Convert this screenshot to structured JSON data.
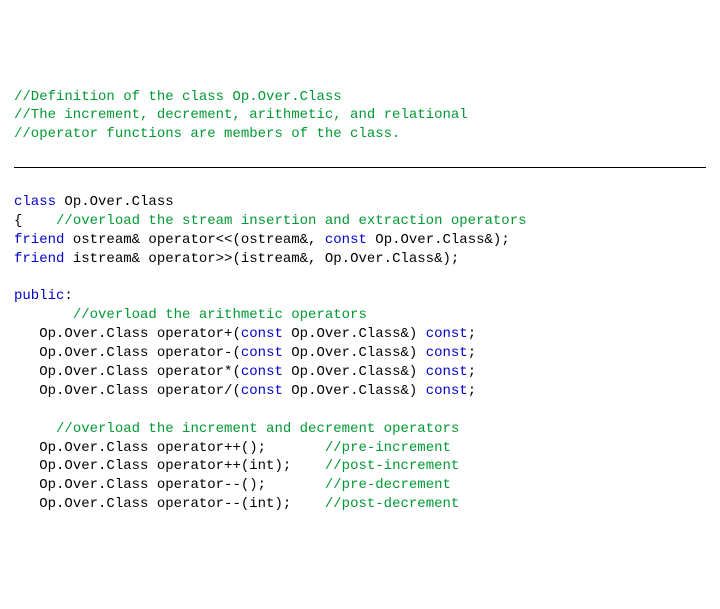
{
  "header_comments": [
    "//Definition of the class Op.Over.Class",
    "//The increment, decrement, arithmetic, and relational",
    "//operator functions are members of the class."
  ],
  "class_decl": {
    "kw": "class",
    "name": "Op.Over.Class"
  },
  "stream_block": {
    "open_brace": "{",
    "comment": "//overload the stream insertion and extraction operators",
    "line1": {
      "kw": "friend",
      "rest": " ostream& operator<<(ostream&, ",
      "const_kw": "const",
      "tail": " Op.Over.Class&);"
    },
    "line2": {
      "kw": "friend",
      "rest": " istream& operator>>(istream&, Op.Over.Class&);"
    }
  },
  "public_kw": "public",
  "public_colon": ":",
  "arith_comment": "//overload the arithmetic operators",
  "arith_ops": [
    {
      "ret": "Op.Over.Class",
      "fn": "operator+(",
      "ckw": "const",
      "arg": " Op.Over.Class&) ",
      "tkw": "const",
      "end": ";"
    },
    {
      "ret": "Op.Over.Class",
      "fn": "operator-(",
      "ckw": "const",
      "arg": " Op.Over.Class&) ",
      "tkw": "const",
      "end": ";"
    },
    {
      "ret": "Op.Over.Class",
      "fn": "operator*(",
      "ckw": "const",
      "arg": " Op.Over.Class&) ",
      "tkw": "const",
      "end": ";"
    },
    {
      "ret": "Op.Over.Class",
      "fn": "operator/(",
      "ckw": "const",
      "arg": " Op.Over.Class&) ",
      "tkw": "const",
      "end": ";"
    }
  ],
  "incdec_comment": "//overload the increment and decrement operators",
  "incdec_ops": [
    {
      "ret": "Op.Over.Class",
      "fn": "operator++();",
      "pad": "       ",
      "cmt": "//pre-increment"
    },
    {
      "ret": "Op.Over.Class",
      "fn": "operator++(int);",
      "pad": "    ",
      "cmt": "//post-increment"
    },
    {
      "ret": "Op.Over.Class",
      "fn": "operator--();",
      "pad": "       ",
      "cmt": "//pre-decrement"
    },
    {
      "ret": "Op.Over.Class",
      "fn": "operator--(int);",
      "pad": "    ",
      "cmt": "//post-decrement"
    }
  ]
}
